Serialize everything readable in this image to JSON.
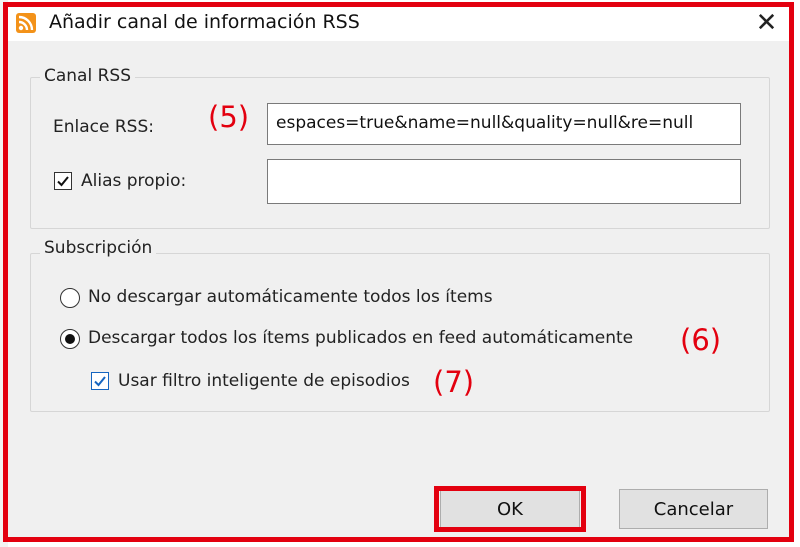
{
  "dialog": {
    "title": "Añadir canal de información RSS",
    "close_glyph": "✕"
  },
  "rss_group": {
    "legend": "Canal RSS",
    "link_label": "Enlace RSS:",
    "link_value": "espaces=true&name=null&quality=null&re=null",
    "alias_label": "Alias propio:",
    "alias_checked": true,
    "alias_value": ""
  },
  "subscription_group": {
    "legend": "Subscripción",
    "option_no_download": "No descargar automáticamente todos los ítems",
    "option_download_all": "Descargar todos los ítems publicados en feed automáticamente",
    "selected_option": "option_download_all",
    "smart_filter_label": "Usar filtro inteligente de episodios",
    "smart_filter_checked": true
  },
  "annotations": {
    "five": "(5)",
    "six": "(6)",
    "seven": "(7)"
  },
  "buttons": {
    "ok": "OK",
    "cancel": "Cancelar"
  },
  "colors": {
    "annotation_red": "#e3000f",
    "rss_icon_orange": "#f39219",
    "checkbox_blue": "#1565c0"
  },
  "icons": {
    "window": "rss-feed-icon",
    "close": "close-icon",
    "check": "check-icon"
  }
}
